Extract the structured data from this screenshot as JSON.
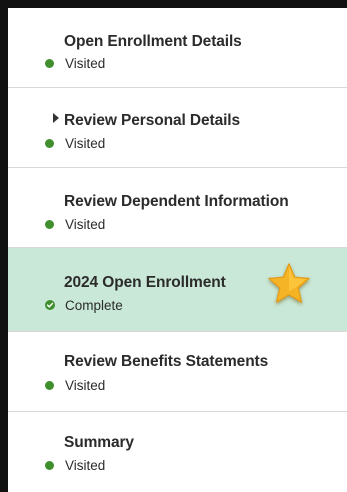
{
  "steps": [
    {
      "title": "Open Enrollment Details",
      "status": "Visited"
    },
    {
      "title": "Review Personal Details",
      "status": "Visited"
    },
    {
      "title": "Review Dependent Information",
      "status": "Visited"
    },
    {
      "title": "2024 Open Enrollment",
      "status": "Complete"
    },
    {
      "title": "Review Benefits Statements",
      "status": "Visited"
    },
    {
      "title": "Summary",
      "status": "Visited"
    }
  ],
  "colors": {
    "visited_dot": "#3f8f2f",
    "active_background": "#c9e8d8",
    "star": "#f5b325"
  },
  "icons": {
    "status_visited": "green-dot-icon",
    "status_complete": "check-circle-icon",
    "expand": "caret-right-icon",
    "highlight": "star-icon"
  }
}
